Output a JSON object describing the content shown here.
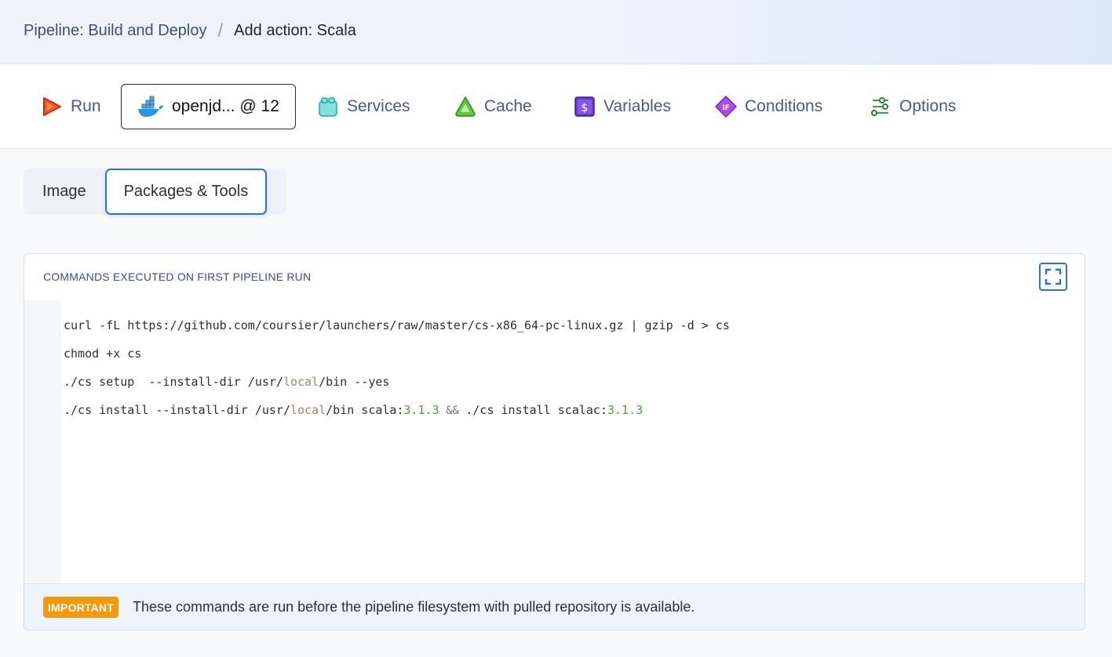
{
  "breadcrumb": {
    "parent": "Pipeline: Build and Deploy",
    "separator": "/",
    "current": "Add action: Scala"
  },
  "tabs": [
    {
      "label": "Run",
      "icon": "play-icon"
    },
    {
      "label": "openjd... @ 12",
      "icon": "docker-icon",
      "active": true
    },
    {
      "label": "Services",
      "icon": "services-icon"
    },
    {
      "label": "Cache",
      "icon": "cache-icon"
    },
    {
      "label": "Variables",
      "icon": "variables-icon"
    },
    {
      "label": "Conditions",
      "icon": "conditions-icon"
    },
    {
      "label": "Options",
      "icon": "options-icon"
    }
  ],
  "subtabs": {
    "image": "Image",
    "packages": "Packages & Tools"
  },
  "panel": {
    "title": "COMMANDS EXECUTED ON FIRST PIPELINE RUN",
    "code": {
      "line1": "curl -fL https://github.com/coursier/launchers/raw/master/cs-x86_64-pc-linux.gz | gzip -d > cs",
      "line2": "chmod +x cs",
      "line3_a": "./cs setup  --install-dir /usr/",
      "line3_b": "local",
      "line3_c": "/bin --yes",
      "line4_a": "./cs install --install-dir /usr/",
      "line4_b": "local",
      "line4_c": "/bin scala:",
      "line4_d": "3.1.3",
      "line4_e": " && ",
      "line4_f": "./cs install scalac:",
      "line4_g": "3.1.3"
    },
    "footer": {
      "badge": "IMPORTANT",
      "text": "These commands are run before the pipeline filesystem with pulled repository is available."
    }
  },
  "colors": {
    "accent": "#2f6fe4",
    "badge": "#f29a0e",
    "keyword": "#9b8a6b",
    "number": "#43a833"
  }
}
